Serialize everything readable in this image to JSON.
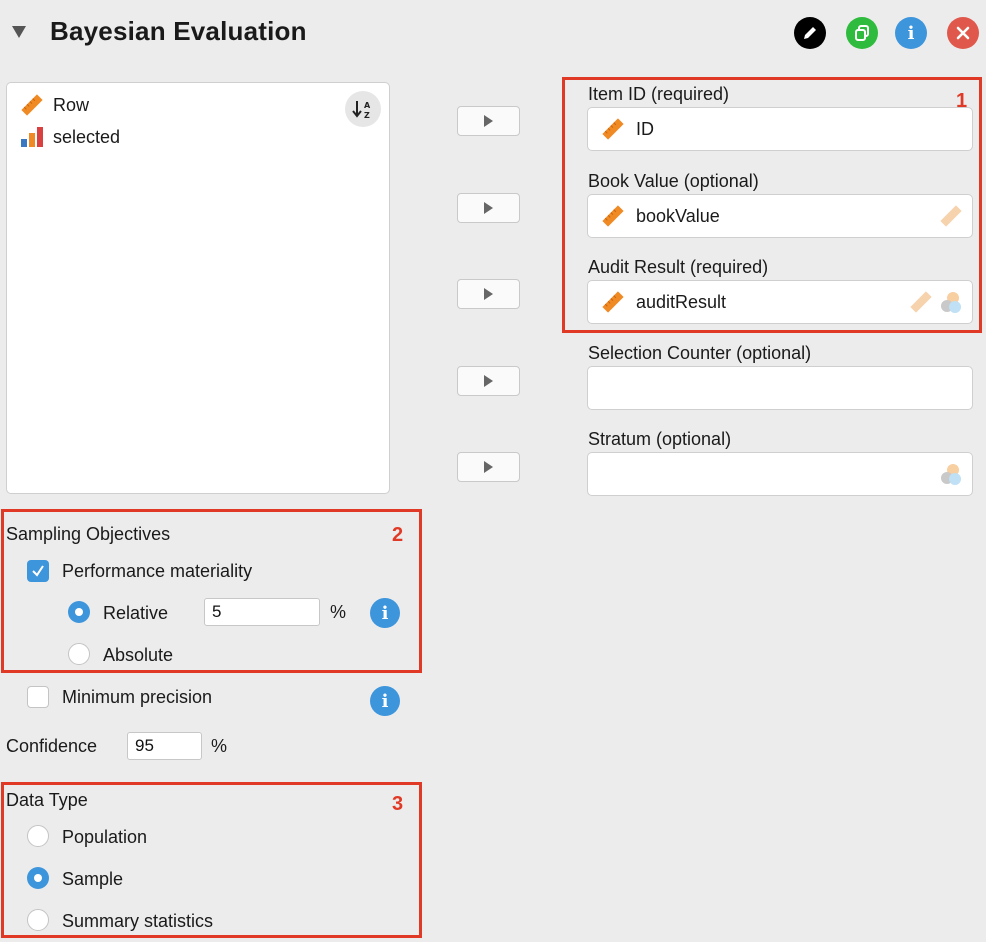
{
  "header": {
    "title": "Bayesian Evaluation"
  },
  "variables": {
    "items": [
      {
        "label": "Row",
        "icon": "ruler-scale-icon"
      },
      {
        "label": "selected",
        "icon": "bar-chart-icon"
      }
    ],
    "sort_label": "↓A Z"
  },
  "fields": [
    {
      "label": "Item ID (required)",
      "value": "ID"
    },
    {
      "label": "Book Value (optional)",
      "value": "bookValue"
    },
    {
      "label": "Audit Result (required)",
      "value": "auditResult"
    },
    {
      "label": "Selection Counter (optional)",
      "value": ""
    },
    {
      "label": "Stratum (optional)",
      "value": ""
    }
  ],
  "annotations": {
    "n1": "1",
    "n2": "2",
    "n3": "3"
  },
  "sampling": {
    "title": "Sampling Objectives",
    "performance_materiality": "Performance materiality",
    "relative": "Relative",
    "relative_value": "5",
    "percent": "%",
    "absolute": "Absolute",
    "minimum_precision": "Minimum precision"
  },
  "confidence": {
    "label": "Confidence",
    "value": "95",
    "unit": "%"
  },
  "data_type": {
    "title": "Data Type",
    "options": [
      "Population",
      "Sample",
      "Summary statistics"
    ],
    "selected": "Sample"
  },
  "colors": {
    "accent": "#3d95dc",
    "annotation": "#e03a26",
    "scale_orange": "#f08a24"
  }
}
